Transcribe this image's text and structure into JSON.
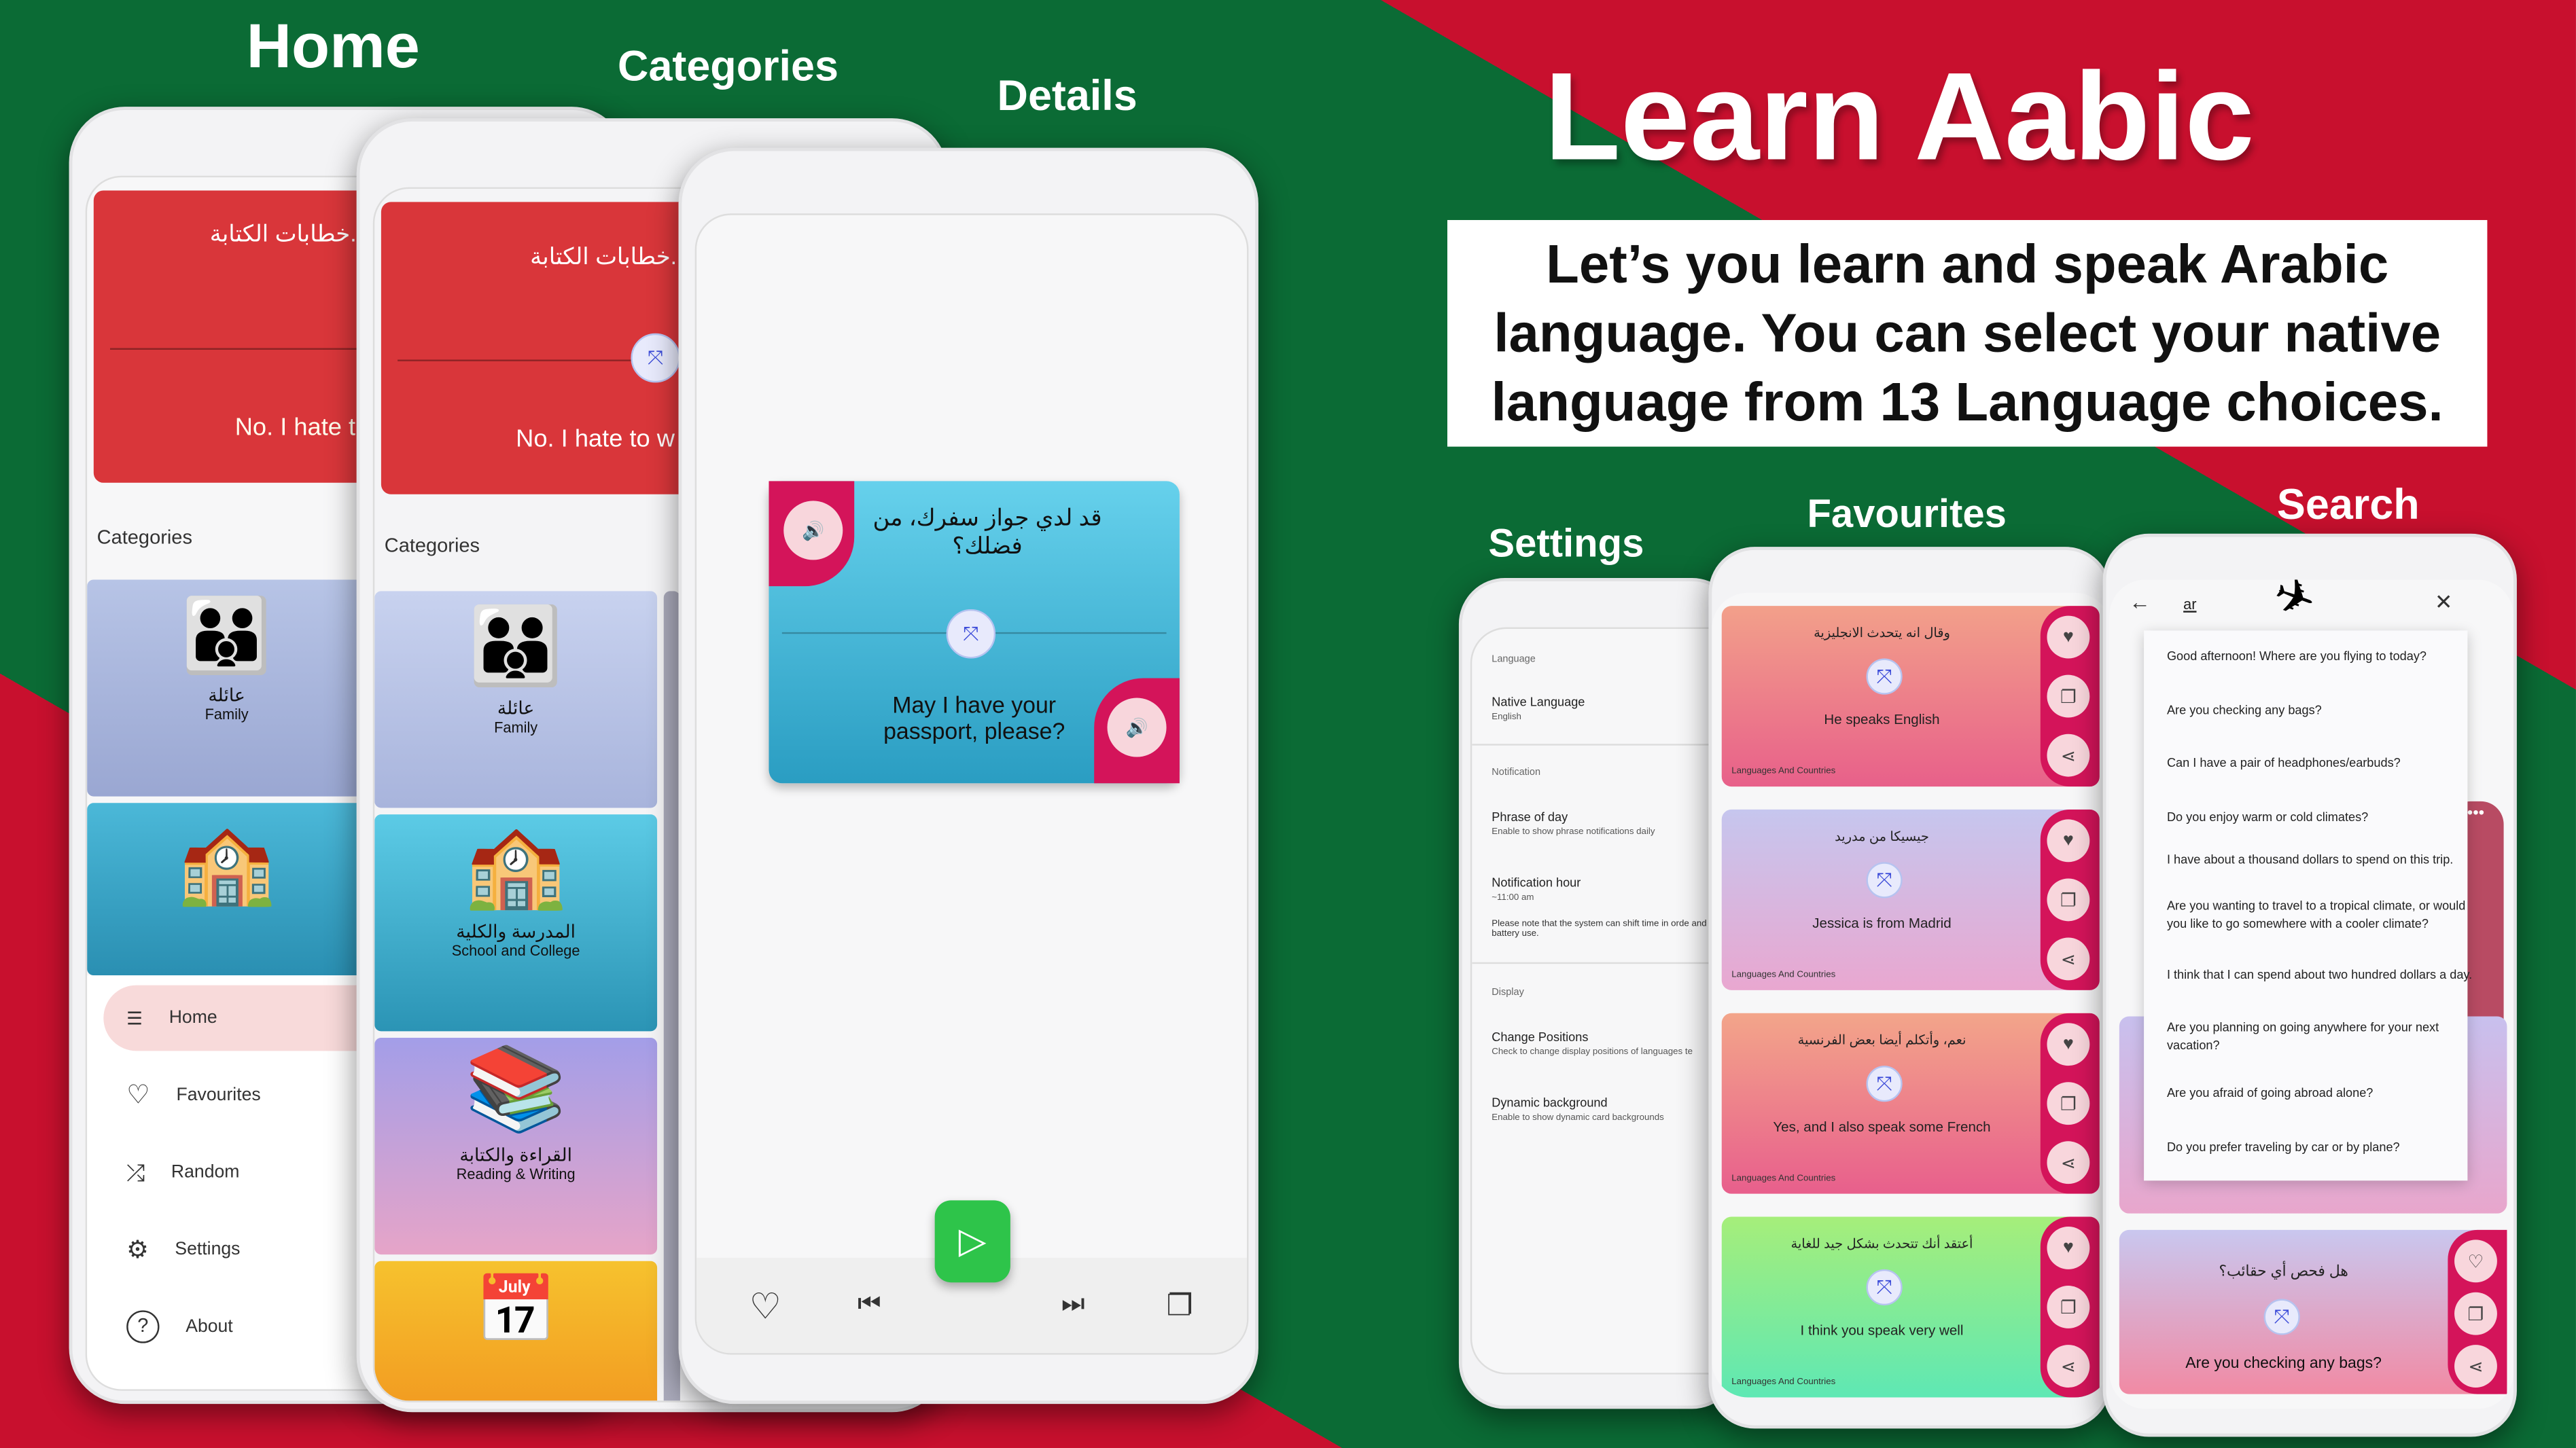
{
  "headings": {
    "home": "Home",
    "categories": "Categories",
    "details": "Details",
    "settings": "Settings",
    "favourites": "Favourites",
    "search": "Search"
  },
  "hero": {
    "title": "Learn Aabic",
    "subtitle": "Let’s you learn and speak Arabic language. You can select your native language from 13 Language choices."
  },
  "colors": {
    "green": "#0b6b35",
    "red": "#c8102e",
    "card_red": "#d9363a",
    "accent_pink": "#d4145a",
    "play_green": "#2ec44a"
  },
  "home": {
    "card_ar": "خطابات الكتابة.",
    "card_en": "No. I hate t",
    "categories_label": "Categories",
    "categories": [
      {
        "ar": "عائلة",
        "en": "Family"
      },
      {
        "ar": "المدرسة والكلية",
        "en": "School and College"
      }
    ],
    "nav": [
      {
        "label": "Home",
        "icon": "list-icon"
      },
      {
        "label": "Favourites",
        "icon": "heart-icon"
      },
      {
        "label": "Random",
        "icon": "shuffle-icon"
      },
      {
        "label": "Settings",
        "icon": "gear-icon"
      },
      {
        "label": "About",
        "icon": "help-icon"
      }
    ]
  },
  "categories_screen": {
    "card_ar": "خطابات الكتابة.",
    "card_en": "No. I hate to w",
    "categories_label": "Categories",
    "categories": [
      {
        "ar": "عائلة",
        "en": "Family"
      },
      {
        "ar": "المدرسة والكلية",
        "en": "School and College"
      },
      {
        "ar": "القراءة والكتابة",
        "en": "Reading & Writing"
      }
    ]
  },
  "details": {
    "ar": "قد لدي جواز سفرك، من فضلك؟",
    "en": "May I have your passport, please?"
  },
  "settings": {
    "sections": [
      {
        "header": "Language",
        "items": [
          {
            "title": "Native Language",
            "sub": "English"
          }
        ]
      },
      {
        "header": "Notification",
        "items": [
          {
            "title": "Phrase of day",
            "sub": "Enable to show phrase notifications daily"
          },
          {
            "title": "Notification hour",
            "sub": "~11:00 am"
          }
        ],
        "note": "Please note that the system can shift time in orde and battery use."
      },
      {
        "header": "Display",
        "items": [
          {
            "title": "Change Positions",
            "sub": "Check to change display positions of languages te"
          },
          {
            "title": "Dynamic background",
            "sub": "Enable to show dynamic card backgrounds"
          }
        ]
      }
    ]
  },
  "favourites": {
    "items": [
      {
        "ar": "وقال انه يتحدث الانجليزية",
        "en": "He speaks English",
        "tag": "Languages And Countries"
      },
      {
        "ar": "جيسيكا من مدريد",
        "en": "Jessica is from Madrid",
        "tag": "Languages And Countries"
      },
      {
        "ar": "نعم، وأتكلم أيضا بعض الفرنسية",
        "en": "Yes, and I also speak some French",
        "tag": "Languages And Countries"
      },
      {
        "ar": "أعتقد أنك تتحدث بشكل جيد للغاية",
        "en": "I think you speak very well",
        "tag": "Languages And Countries"
      }
    ]
  },
  "search": {
    "query": "ar",
    "results": [
      "Good afternoon! Where are you flying to today?",
      "Are you checking any bags?",
      "Can I have a pair of headphones/earbuds?",
      "Do you enjoy warm or cold climates?",
      "I have about a thousand dollars to spend on this trip.",
      "Are you wanting to travel to a tropical climate, or would you like to go somewhere with a cooler climate?",
      "I think that I can spend about two hundred dollars a day.",
      "Are you planning on going anywhere for your next vacation?",
      "Are you afraid of going abroad alone?",
      "Do you prefer traveling by car or by plane?"
    ],
    "card_ar": "هل فحص أي حقائب؟",
    "card_en": "Are you checking any bags?"
  }
}
